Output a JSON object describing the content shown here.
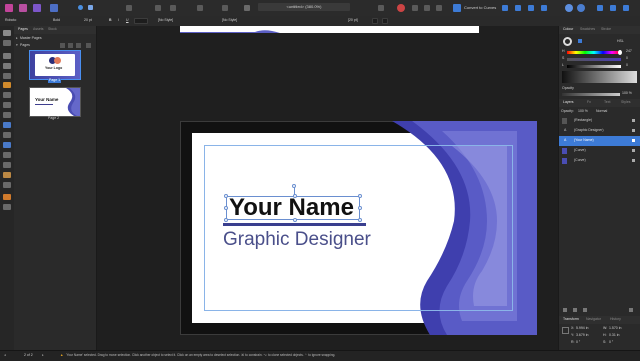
{
  "toolbar": {
    "zoom_label": "<untitled> (380.0%)",
    "convert_to_curves_label": "Convert to Curves",
    "accent_color": "#3d7bd6"
  },
  "context": {
    "font_family": "Roboto",
    "font_weight": "Bold",
    "font_size": "20 pt",
    "char_style": "[No Style]",
    "para_style": "[No Style]",
    "size2": "[20 pt]"
  },
  "pages_panel": {
    "tabs": [
      "Pages",
      "Assets",
      "Stock"
    ],
    "master_pages_label": "Master Pages",
    "pages_label": "Pages",
    "pages": [
      {
        "label": "Page 1",
        "thumb_text": "Your Logo"
      },
      {
        "label": "Page 2",
        "thumb_text": "Your Name"
      }
    ]
  },
  "card": {
    "name": "Your Name",
    "title": "Graphic Designer",
    "accent": "#5e5fbd",
    "name_color": "#111111",
    "title_color": "#4a4f8a"
  },
  "color_panel": {
    "tabs": [
      "Colour",
      "Swatches",
      "Stroke"
    ],
    "model": "HSL",
    "h_value": "247",
    "s_value": "0",
    "l_value": "0",
    "opacity_label": "Opacity",
    "opacity_value": "100 %"
  },
  "layers_panel": {
    "tabs": [
      "Layers",
      "Fx",
      "Text",
      "Styles"
    ],
    "opacity_label": "Opacity:",
    "opacity_value": "100 %",
    "blend_mode": "Normal",
    "layers": [
      {
        "name": "(Rectangle)",
        "selected": false
      },
      {
        "name": "(Graphic Designer)",
        "selected": false
      },
      {
        "name": "(Your Name)",
        "selected": true
      },
      {
        "name": "(Curve)",
        "selected": false
      },
      {
        "name": "(Curve)",
        "selected": false
      }
    ]
  },
  "transform_panel": {
    "tabs": [
      "Transform",
      "Navigator",
      "History"
    ],
    "x_label": "X:",
    "x_value": "5.994 in",
    "y_label": "Y:",
    "y_value": "3.679 in",
    "w_label": "W:",
    "w_value": "1.570 in",
    "h_label": "H:",
    "h_value": "0.31 in",
    "r_label": "R:",
    "r_value": "0 °",
    "s_label": "S:",
    "s_value": "0 °"
  },
  "status": {
    "page_counter": "2 of 2",
    "message": "'Your Name' selected. Drag to move selection. Click another object to select it. Click on an empty area to deselect selection. ⌘ to constrain. ⌥ to clone selected objects. ⌃ to ignore snapping."
  }
}
